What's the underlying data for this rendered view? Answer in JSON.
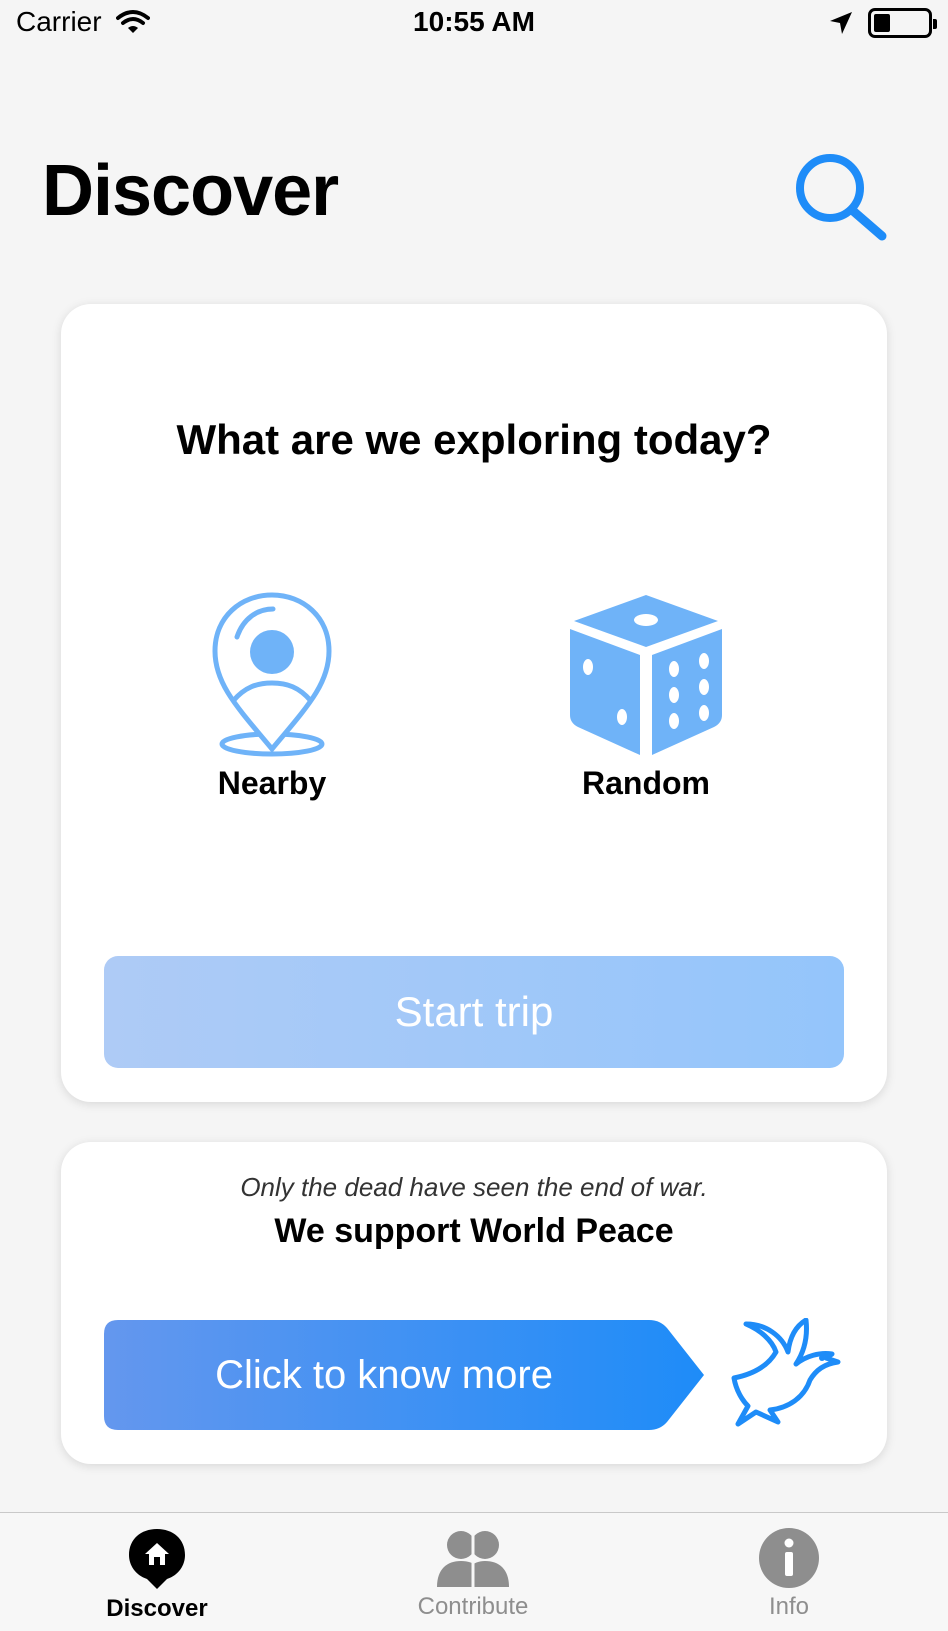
{
  "status_bar": {
    "carrier": "Carrier",
    "time": "10:55 AM"
  },
  "header": {
    "title": "Discover"
  },
  "explore_card": {
    "heading": "What are we exploring today?",
    "options": [
      {
        "label": "Nearby",
        "icon": "location-pin-icon"
      },
      {
        "label": "Random",
        "icon": "dice-icon"
      }
    ],
    "start_button": "Start trip"
  },
  "peace_card": {
    "quote": "Only the dead have seen the end of war.",
    "heading": "We support World Peace",
    "button": "Click to know more",
    "icon": "dove-icon"
  },
  "tab_bar": {
    "tabs": [
      {
        "label": "Discover",
        "icon": "discover-pin-icon",
        "active": true
      },
      {
        "label": "Contribute",
        "icon": "people-icon",
        "active": false
      },
      {
        "label": "Info",
        "icon": "info-icon",
        "active": false
      }
    ]
  },
  "colors": {
    "accent": "#1e8cf8",
    "icon_light_blue": "#6fb3f8",
    "start_button_start": "#aecbf6",
    "start_button_end": "#94c5fb",
    "know_more_start": "#6497ee",
    "know_more_end": "#1e8cf8",
    "tab_inactive": "#8e8e8e"
  }
}
